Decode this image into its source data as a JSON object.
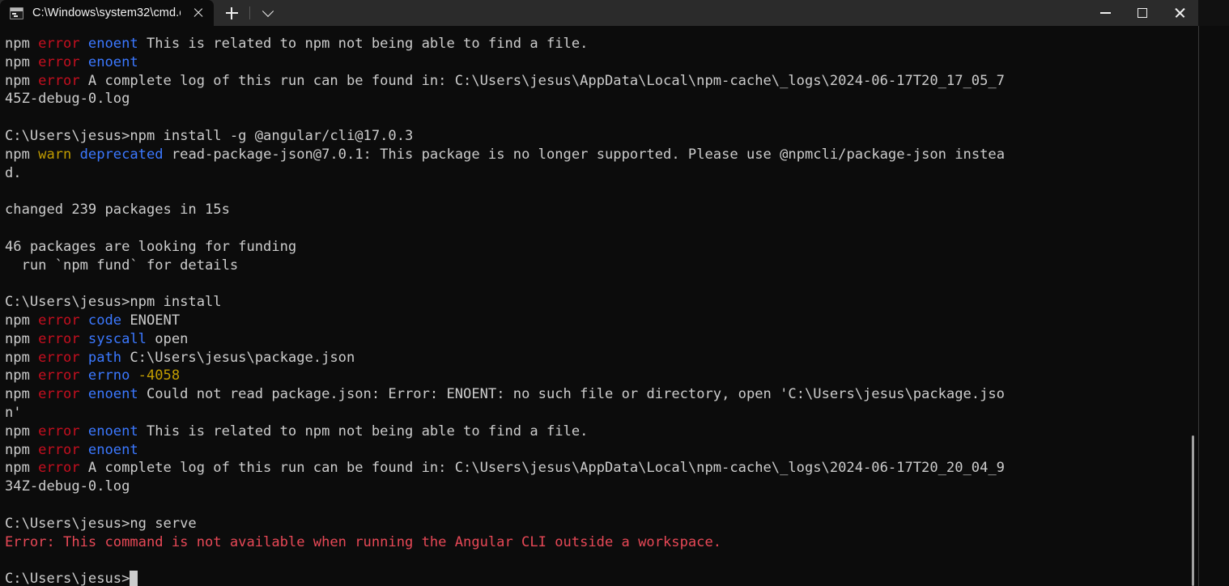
{
  "window": {
    "tab": {
      "title": "C:\\Windows\\system32\\cmd.e",
      "icon": "cmd-console-icon",
      "close_label": "Close tab"
    },
    "new_tab_label": "+",
    "dropdown_label": "v",
    "controls": {
      "minimize": "Minimize",
      "maximize": "Maximize",
      "close": "Close"
    }
  },
  "theme": {
    "background": "#0c0c0c",
    "titlebar": "#2b2b2b",
    "foreground": "#cccccc",
    "red": "#c50f1f",
    "bright_red": "#e74856",
    "blue": "#3b78ff",
    "yellow": "#c19c00"
  },
  "terminal": {
    "prompt": "C:\\Users\\jesus>",
    "cursor_visible": true,
    "lines": [
      {
        "segments": [
          {
            "text": "npm ",
            "color": "white"
          },
          {
            "text": "error ",
            "color": "red"
          },
          {
            "text": "enoent ",
            "color": "blue"
          },
          {
            "text": "This is related to npm not being able to find a file.",
            "color": "white"
          }
        ]
      },
      {
        "segments": [
          {
            "text": "npm ",
            "color": "white"
          },
          {
            "text": "error ",
            "color": "red"
          },
          {
            "text": "enoent",
            "color": "blue"
          }
        ]
      },
      {
        "segments": [
          {
            "text": "npm ",
            "color": "white"
          },
          {
            "text": "error ",
            "color": "red"
          },
          {
            "text": "A complete log of this run can be found in: C:\\Users\\jesus\\AppData\\Local\\npm-cache\\_logs\\2024-06-17T20_17_05_7",
            "color": "white"
          }
        ]
      },
      {
        "segments": [
          {
            "text": "45Z-debug-0.log",
            "color": "white"
          }
        ]
      },
      {
        "segments": [
          {
            "text": "",
            "color": "white"
          }
        ]
      },
      {
        "segments": [
          {
            "text": "C:\\Users\\jesus>npm install -g @angular/cli@17.0.3",
            "color": "white"
          }
        ]
      },
      {
        "segments": [
          {
            "text": "npm ",
            "color": "white"
          },
          {
            "text": "warn ",
            "color": "yellow"
          },
          {
            "text": "deprecated ",
            "color": "blue"
          },
          {
            "text": "read-package-json@7.0.1: This package is no longer supported. Please use @npmcli/package-json instea",
            "color": "white"
          }
        ]
      },
      {
        "segments": [
          {
            "text": "d.",
            "color": "white"
          }
        ]
      },
      {
        "segments": [
          {
            "text": "",
            "color": "white"
          }
        ]
      },
      {
        "segments": [
          {
            "text": "changed 239 packages in 15s",
            "color": "white"
          }
        ]
      },
      {
        "segments": [
          {
            "text": "",
            "color": "white"
          }
        ]
      },
      {
        "segments": [
          {
            "text": "46 packages are looking for funding",
            "color": "white"
          }
        ]
      },
      {
        "segments": [
          {
            "text": "  run `npm fund` for details",
            "color": "white"
          }
        ]
      },
      {
        "segments": [
          {
            "text": "",
            "color": "white"
          }
        ]
      },
      {
        "segments": [
          {
            "text": "C:\\Users\\jesus>npm install",
            "color": "white"
          }
        ]
      },
      {
        "segments": [
          {
            "text": "npm ",
            "color": "white"
          },
          {
            "text": "error ",
            "color": "red"
          },
          {
            "text": "code ",
            "color": "blue"
          },
          {
            "text": "ENOENT",
            "color": "white"
          }
        ]
      },
      {
        "segments": [
          {
            "text": "npm ",
            "color": "white"
          },
          {
            "text": "error ",
            "color": "red"
          },
          {
            "text": "syscall ",
            "color": "blue"
          },
          {
            "text": "open",
            "color": "white"
          }
        ]
      },
      {
        "segments": [
          {
            "text": "npm ",
            "color": "white"
          },
          {
            "text": "error ",
            "color": "red"
          },
          {
            "text": "path ",
            "color": "blue"
          },
          {
            "text": "C:\\Users\\jesus\\package.json",
            "color": "white"
          }
        ]
      },
      {
        "segments": [
          {
            "text": "npm ",
            "color": "white"
          },
          {
            "text": "error ",
            "color": "red"
          },
          {
            "text": "errno ",
            "color": "blue"
          },
          {
            "text": "-4058",
            "color": "yellow"
          }
        ]
      },
      {
        "segments": [
          {
            "text": "npm ",
            "color": "white"
          },
          {
            "text": "error ",
            "color": "red"
          },
          {
            "text": "enoent ",
            "color": "blue"
          },
          {
            "text": "Could not read package.json: Error: ENOENT: no such file or directory, open 'C:\\Users\\jesus\\package.jso",
            "color": "white"
          }
        ]
      },
      {
        "segments": [
          {
            "text": "n'",
            "color": "white"
          }
        ]
      },
      {
        "segments": [
          {
            "text": "npm ",
            "color": "white"
          },
          {
            "text": "error ",
            "color": "red"
          },
          {
            "text": "enoent ",
            "color": "blue"
          },
          {
            "text": "This is related to npm not being able to find a file.",
            "color": "white"
          }
        ]
      },
      {
        "segments": [
          {
            "text": "npm ",
            "color": "white"
          },
          {
            "text": "error ",
            "color": "red"
          },
          {
            "text": "enoent",
            "color": "blue"
          }
        ]
      },
      {
        "segments": [
          {
            "text": "npm ",
            "color": "white"
          },
          {
            "text": "error ",
            "color": "red"
          },
          {
            "text": "A complete log of this run can be found in: C:\\Users\\jesus\\AppData\\Local\\npm-cache\\_logs\\2024-06-17T20_20_04_9",
            "color": "white"
          }
        ]
      },
      {
        "segments": [
          {
            "text": "34Z-debug-0.log",
            "color": "white"
          }
        ]
      },
      {
        "segments": [
          {
            "text": "",
            "color": "white"
          }
        ]
      },
      {
        "segments": [
          {
            "text": "C:\\Users\\jesus>ng serve",
            "color": "white"
          }
        ]
      },
      {
        "segments": [
          {
            "text": "Error: This command is not available when running the Angular CLI outside a workspace.",
            "color": "brightred"
          }
        ]
      },
      {
        "segments": [
          {
            "text": "",
            "color": "white"
          }
        ]
      },
      {
        "segments": [
          {
            "text": "C:\\Users\\jesus>",
            "color": "white"
          },
          {
            "cursor": true
          }
        ]
      }
    ]
  }
}
